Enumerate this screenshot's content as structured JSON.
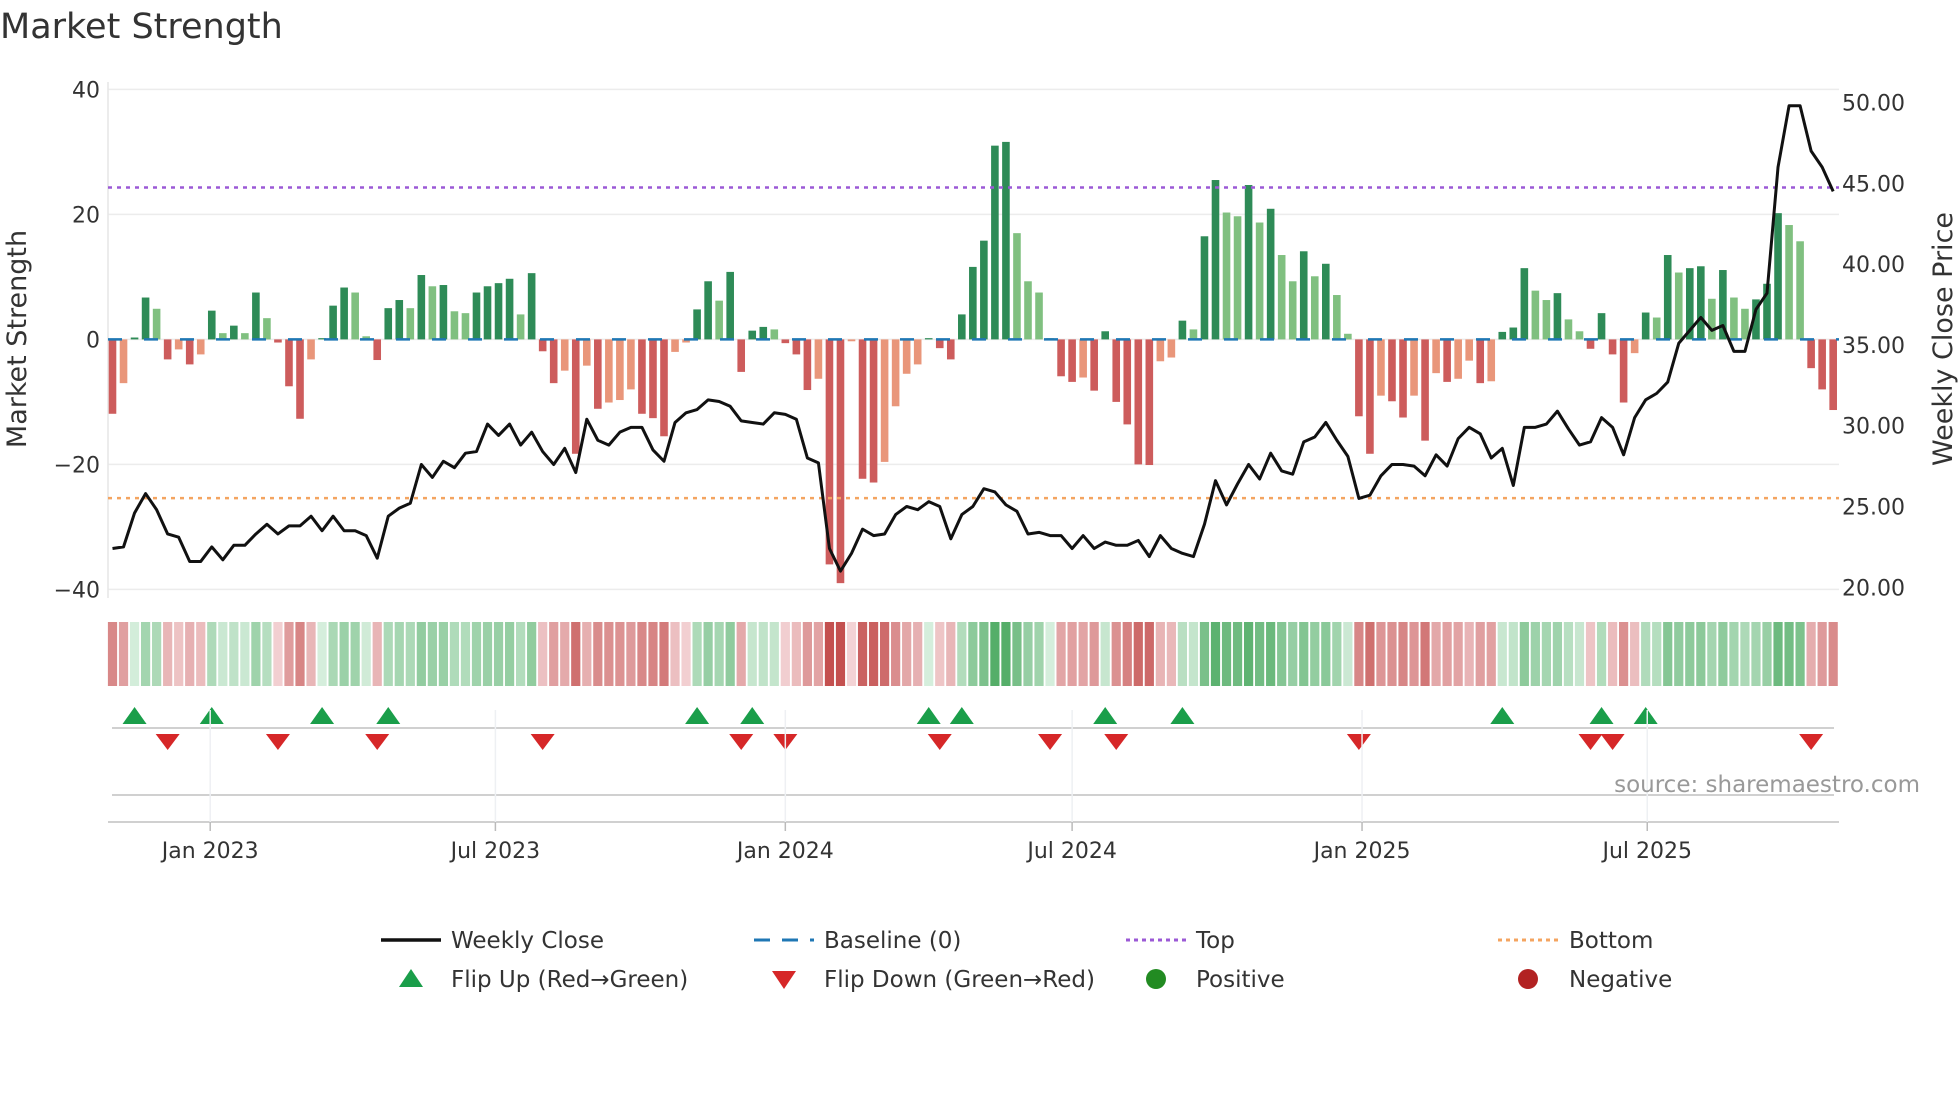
{
  "chart_data": {
    "type": "bar",
    "title": "Market Strength",
    "ylabel": "Market Strength",
    "y2label": "Weekly Close Price",
    "ylim": [
      -42,
      42
    ],
    "y2lim": [
      19.5,
      51.5
    ],
    "yticks": [
      40,
      20,
      0,
      -20,
      -40
    ],
    "yticklabels": [
      "40",
      "20",
      "0",
      "−20",
      "−40"
    ],
    "y2ticks": [
      50,
      45,
      40,
      35,
      30,
      25,
      20
    ],
    "y2ticklabels": [
      "50.00",
      "45.00",
      "40.00",
      "35.00",
      "30.00",
      "25.00",
      "20.00"
    ],
    "x_start": "2022-10-31",
    "x_freq": "weekly",
    "xticks": [
      "2023-01-01",
      "2023-07-01",
      "2024-01-01",
      "2024-07-01",
      "2025-01-01",
      "2025-07-01"
    ],
    "xticklabels": [
      "Jan 2023",
      "Jul 2023",
      "Jan 2024",
      "Jul 2024",
      "Jan 2025",
      "Jul 2025"
    ],
    "top_level": 24.3,
    "bottom_level": -25.4,
    "baseline": 0,
    "series": [
      {
        "name": "Market Strength",
        "type": "bar",
        "values": [
          -11.9,
          -7,
          0.3,
          6.7,
          4.9,
          -3.2,
          -1.6,
          -4,
          -2.4,
          4.6,
          1,
          2.2,
          1,
          7.5,
          3.4,
          -0.5,
          -7.5,
          -12.7,
          -3.2,
          0.2,
          5.4,
          8.3,
          7.5,
          0.5,
          -3.3,
          5,
          6.3,
          5,
          10.3,
          8.5,
          8.7,
          4.5,
          4.2,
          7.5,
          8.5,
          9,
          9.7,
          4,
          10.6,
          -1.9,
          -7,
          -5,
          -18.3,
          -4.2,
          -11.1,
          -10.1,
          -9.7,
          -8,
          -11.9,
          -12.6,
          -15.5,
          -2,
          -0.5,
          4.8,
          9.3,
          6.2,
          10.8,
          -5.2,
          1.4,
          2,
          1.6,
          -0.6,
          -2.4,
          -8.1,
          -6.3,
          -36,
          -39,
          -0.3,
          -22.3,
          -22.9,
          -19.6,
          -10.7,
          -5.5,
          -4,
          0.2,
          -1.4,
          -3.2,
          4,
          11.6,
          15.8,
          31,
          31.6,
          17,
          9.3,
          7.5,
          0.2,
          -5.9,
          -6.8,
          -6.1,
          -8.2,
          1.3,
          -10,
          -13.6,
          -20,
          -20.1,
          -3.5,
          -2.9,
          3,
          1.6,
          16.5,
          25.5,
          20.3,
          19.7,
          24.7,
          18.7,
          20.9,
          13.5,
          9.3,
          14.1,
          10.1,
          12.1,
          7.1,
          0.9,
          -12.3,
          -18.3,
          -9,
          -9.9,
          -12.5,
          -9,
          -16.2,
          -5.4,
          -6.8,
          -6.3,
          -3.4,
          -7,
          -6.7,
          1.2,
          1.9,
          11.4,
          7.8,
          6.3,
          7.4,
          3.2,
          1.3,
          -1.5,
          4.2,
          -2.4,
          -10.1,
          -2.2,
          4.3,
          3.5,
          13.5,
          10.7,
          11.4,
          11.7,
          6.5,
          11.1,
          6.7,
          4.9,
          6.4,
          8.9,
          20.2,
          18.3,
          15.7,
          -4.6,
          -8,
          -11.3
        ]
      },
      {
        "name": "Weekly Close",
        "type": "line",
        "axis": "right",
        "values": [
          22.4,
          22.5,
          24.6,
          25.8,
          24.8,
          23.3,
          23.1,
          21.6,
          21.6,
          22.5,
          21.7,
          22.6,
          22.6,
          23.3,
          23.9,
          23.3,
          23.8,
          23.8,
          24.4,
          23.5,
          24.4,
          23.5,
          23.5,
          23.2,
          21.8,
          24.4,
          24.9,
          25.2,
          27.6,
          26.8,
          27.8,
          27.4,
          28.3,
          28.4,
          30.1,
          29.4,
          30.1,
          28.8,
          29.6,
          28.4,
          27.6,
          28.6,
          27.1,
          30.4,
          29.1,
          28.8,
          29.6,
          29.9,
          29.9,
          28.5,
          27.8,
          30.2,
          30.8,
          31.0,
          31.6,
          31.5,
          31.2,
          30.3,
          30.2,
          30.1,
          30.8,
          30.7,
          30.4,
          28.0,
          27.7,
          22.4,
          21.0,
          22.1,
          23.6,
          23.2,
          23.3,
          24.5,
          25.0,
          24.8,
          25.3,
          25.0,
          23.0,
          24.5,
          25.0,
          26.1,
          25.9,
          25.1,
          24.7,
          23.3,
          23.4,
          23.2,
          23.2,
          22.4,
          23.2,
          22.4,
          22.8,
          22.6,
          22.6,
          22.9,
          21.9,
          23.2,
          22.4,
          22.1,
          21.9,
          23.9,
          26.6,
          25.1,
          26.4,
          27.6,
          26.7,
          28.3,
          27.2,
          27.0,
          29.0,
          29.3,
          30.2,
          29.1,
          28.1,
          25.5,
          25.7,
          26.9,
          27.6,
          27.6,
          27.5,
          26.9,
          28.2,
          27.5,
          29.2,
          29.9,
          29.5,
          28.0,
          28.6,
          26.3,
          29.9,
          29.9,
          30.1,
          30.9,
          29.8,
          28.8,
          29.0,
          30.5,
          29.9,
          28.2,
          30.5,
          31.6,
          32.0,
          32.7,
          35.1,
          35.9,
          36.7,
          35.9,
          36.2,
          34.6,
          34.6,
          37.2,
          38.2,
          46.0,
          49.8,
          49.8,
          47.0,
          46.0,
          44.5
        ]
      }
    ],
    "flip_up_weeks": [
      2,
      9,
      19,
      25,
      53,
      58,
      74,
      77,
      90,
      97,
      126,
      135,
      139
    ],
    "flip_down_weeks": [
      5,
      15,
      24,
      39,
      57,
      61,
      75,
      85,
      91,
      113,
      134,
      136,
      154
    ],
    "legend": {
      "placement": "bottom",
      "items": [
        {
          "label": "Weekly Close",
          "symbol": "line"
        },
        {
          "label": "Baseline (0)",
          "symbol": "dash"
        },
        {
          "label": "Top",
          "symbol": "dot-purple"
        },
        {
          "label": "Bottom",
          "symbol": "dot-orange"
        },
        {
          "label": "Flip Up (Red→Green)",
          "symbol": "triangle-up"
        },
        {
          "label": "Flip Down (Green→Red)",
          "symbol": "triangle-down"
        },
        {
          "label": "Positive",
          "symbol": "circle-green"
        },
        {
          "label": "Negative",
          "symbol": "circle-red"
        }
      ]
    },
    "source": "source: sharemaestro.com",
    "colors": {
      "pos_dark": "#2e8b57",
      "pos_light": "#80c080",
      "neg_dark": "#cd5c5c",
      "neg_light": "#e9967a",
      "baseline": "#1f77b4",
      "top": "#9b59d6",
      "bottom": "#f4a460",
      "line": "#111111",
      "flip_up": "#1a9e4a",
      "flip_down": "#d62728",
      "positive": "#228b22",
      "negative": "#b22222"
    }
  }
}
